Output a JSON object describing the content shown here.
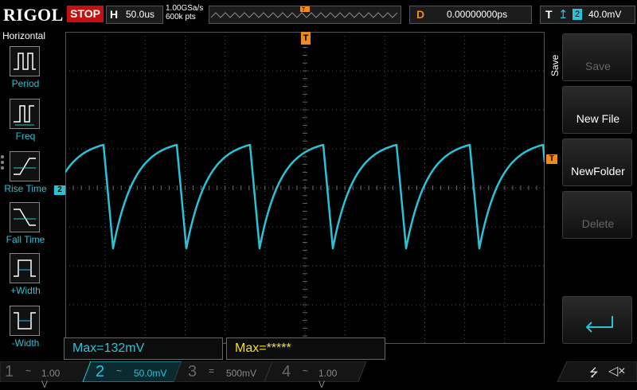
{
  "brand": "RIGOL",
  "run_state": "STOP",
  "horizontal": {
    "label": "H",
    "timebase": "50.0us"
  },
  "acquisition": {
    "sample_rate": "1.00GSa/s",
    "memory_depth": "600k pts"
  },
  "delay": {
    "label": "D",
    "value": "0.00000000ps"
  },
  "trigger": {
    "label": "T",
    "source": "2",
    "level": "40.0mV"
  },
  "left_menu": {
    "title": "Horizontal",
    "items": [
      {
        "label": "Period"
      },
      {
        "label": "Freq"
      },
      {
        "label": "Rise Time"
      },
      {
        "label": "Fall Time"
      },
      {
        "label": "+Width"
      },
      {
        "label": "-Width"
      }
    ]
  },
  "right_menu": {
    "title": "Save",
    "items": [
      {
        "label": "Save",
        "enabled": false
      },
      {
        "label": "New File",
        "enabled": true
      },
      {
        "label": "NewFolder",
        "enabled": true
      },
      {
        "label": "Delete",
        "enabled": false
      },
      {
        "label": "",
        "enabled": true,
        "icon": "enter-icon"
      }
    ]
  },
  "measurements": [
    {
      "text": "Max=132mV",
      "color": "#29c3d8"
    },
    {
      "text": "Max=*****",
      "color": "#f0e020"
    }
  ],
  "channels": [
    {
      "num": "1",
      "coupling": "~",
      "scale": "1.00 V",
      "active": false,
      "color": "#d8d000"
    },
    {
      "num": "2",
      "coupling": "~",
      "scale": "50.0mV",
      "active": true,
      "color": "#29c3d8"
    },
    {
      "num": "3",
      "coupling": "=",
      "scale": "500mV",
      "active": false,
      "color": "#c040c0"
    },
    {
      "num": "4",
      "coupling": "~",
      "scale": "1.00 V",
      "active": false,
      "color": "#3070e0"
    }
  ],
  "markers": {
    "trigger_top": "T",
    "trigger_right": "T",
    "ch2_ground": "2"
  },
  "colors": {
    "ch2_trace": "#29c3d8",
    "trigger": "#f08a1c",
    "stop_bg": "#c41010"
  }
}
